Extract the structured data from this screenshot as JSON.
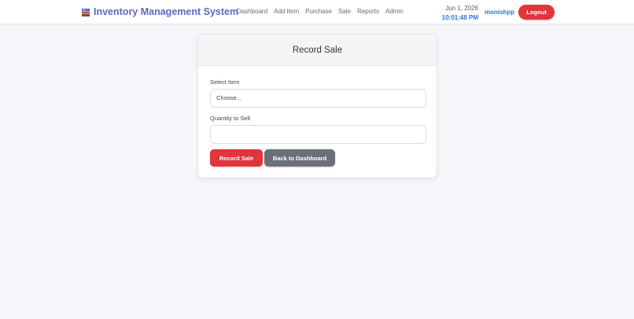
{
  "nav": {
    "brand_title": "Inventory Management System",
    "brand_icon": "boxes-icon",
    "links": [
      {
        "label": "Dashboard"
      },
      {
        "label": "Add Item"
      },
      {
        "label": "Purchase"
      },
      {
        "label": "Sale"
      },
      {
        "label": "Reports"
      },
      {
        "label": "Admin"
      }
    ],
    "date": "Jun 1, 2026",
    "time": "10:01:48 PM",
    "username": "monishpp",
    "logout_label": "Logout"
  },
  "card": {
    "title": "Record Sale",
    "select_label": "Select Item",
    "select_value": "Choose...",
    "quantity_label": "Quantity to Sell",
    "quantity_value": "",
    "record_button": "Record Sale",
    "back_button": "Back to Dashboard"
  },
  "colors": {
    "brand": "#6167c4",
    "accent_blue": "#2f74d4",
    "danger": "#e0353c",
    "secondary": "#6b7078",
    "background": "#f4f6f9"
  }
}
